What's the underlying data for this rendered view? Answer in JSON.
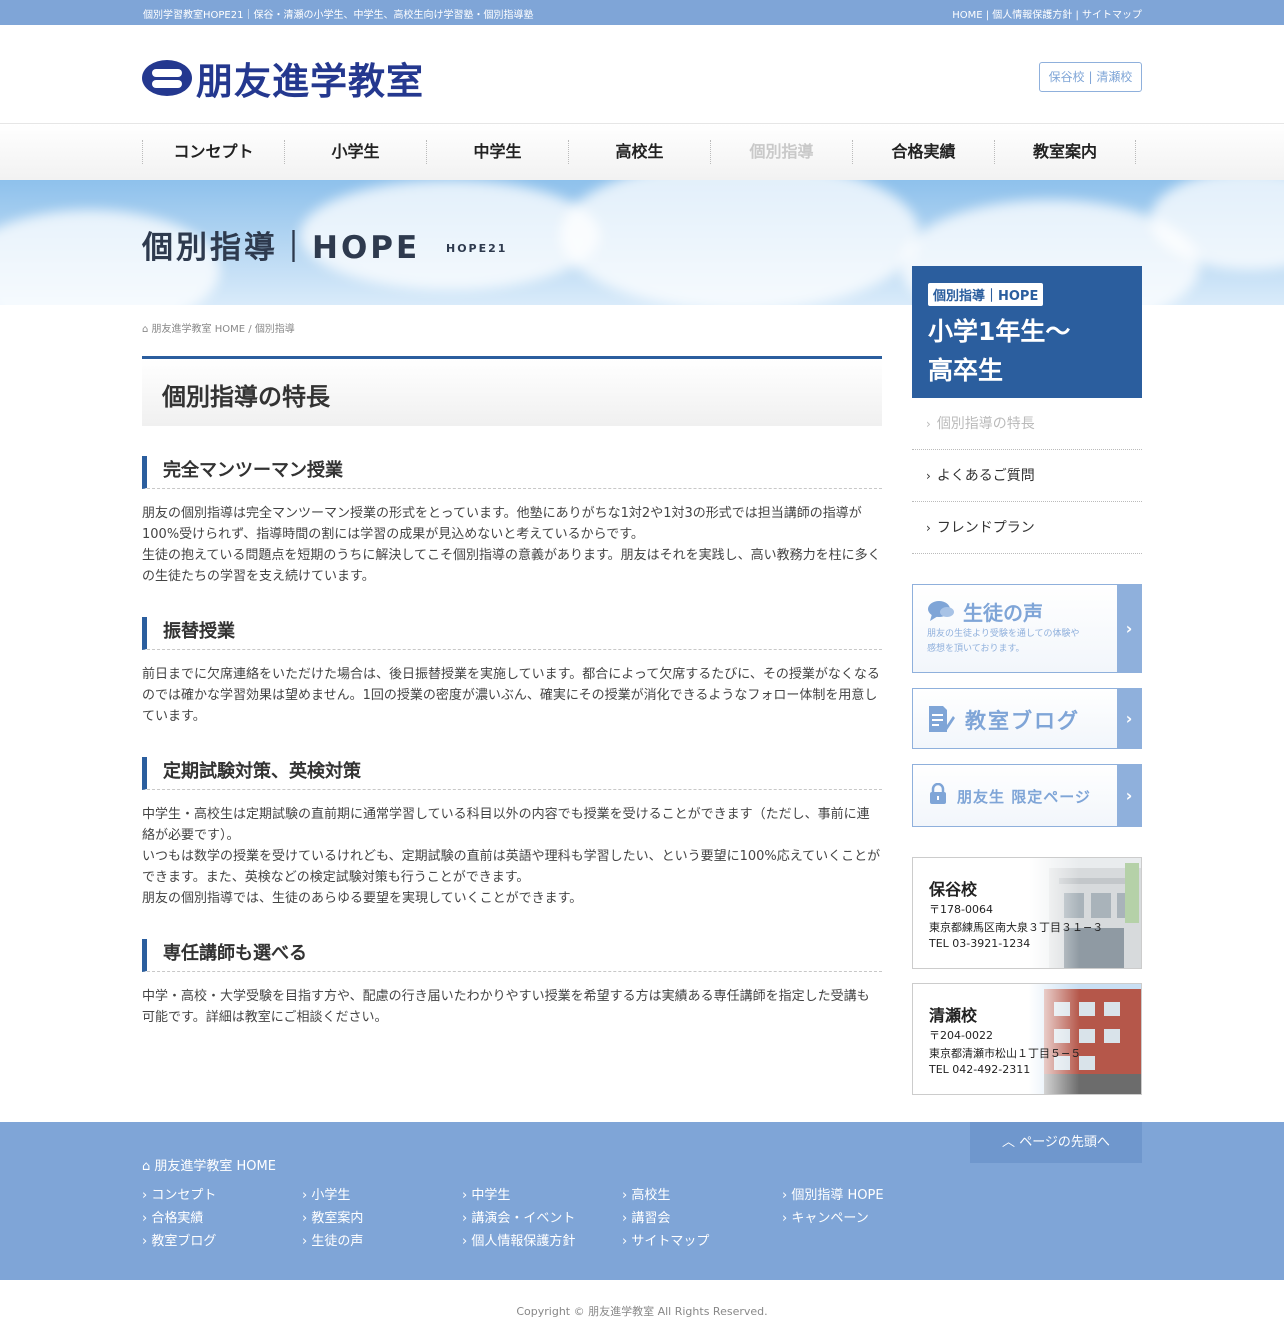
{
  "topbar": {
    "tagline": "個別学習教室HOPE21｜保谷・清瀬の小学生、中学生、高校生向け学習塾・個別指導塾",
    "links": [
      "HOME",
      "個人情報保護方針",
      "サイトマップ"
    ]
  },
  "header": {
    "logo_text": "朋友進学教室",
    "school_links": [
      "保谷校",
      "清瀬校"
    ]
  },
  "nav": {
    "items": [
      {
        "label": "コンセプト"
      },
      {
        "label": "小学生"
      },
      {
        "label": "中学生"
      },
      {
        "label": "高校生"
      },
      {
        "label": "個別指導"
      },
      {
        "label": "合格実績"
      },
      {
        "label": "教室案内"
      }
    ]
  },
  "hero": {
    "title": "個別指導｜HOPE",
    "subtitle": "HOPE21"
  },
  "side_banner": {
    "tag": "個別指導｜HOPE",
    "line1": "小学1年生〜",
    "line2": "高卒生"
  },
  "breadcrumb": {
    "home": "朋友進学教室 HOME",
    "separator": "/",
    "current": "個別指導"
  },
  "page_title": "個別指導の特長",
  "sections": [
    {
      "heading": "完全マンツーマン授業",
      "paragraphs": [
        "朋友の個別指導は完全マンツーマン授業の形式をとっています。他塾にありがちな1対2や1対3の形式では担当講師の指導が100%受けられず、指導時間の割には学習の成果が見込めないと考えているからです。",
        "生徒の抱えている問題点を短期のうちに解決してこそ個別指導の意義があります。朋友はそれを実践し、高い教務力を柱に多くの生徒たちの学習を支え続けています。"
      ]
    },
    {
      "heading": "振替授業",
      "paragraphs": [
        "前日までに欠席連絡をいただけた場合は、後日振替授業を実施しています。都合によって欠席するたびに、その授業がなくなるのでは確かな学習効果は望めません。1回の授業の密度が濃いぶん、確実にその授業が消化できるようなフォロー体制を用意しています。"
      ]
    },
    {
      "heading": "定期試験対策、英検対策",
      "paragraphs": [
        "中学生・高校生は定期試験の直前期に通常学習している科目以外の内容でも授業を受けることができます（ただし、事前に連絡が必要です）。",
        "いつもは数学の授業を受けているけれども、定期試験の直前は英語や理科も学習したい、という要望に100%応えていくことができます。また、英検などの検定試験対策も行うことができます。",
        "朋友の個別指導では、生徒のあらゆる要望を実現していくことができます。"
      ]
    },
    {
      "heading": "専任講師も選べる",
      "paragraphs": [
        "中学・高校・大学受験を目指す方や、配慮の行き届いたわかりやすい授業を希望する方は実績ある専任講師を指定した受講も可能です。詳細は教室にご相談ください。"
      ]
    }
  ],
  "side_nav": [
    {
      "label": "個別指導の特長"
    },
    {
      "label": "よくあるご質問"
    },
    {
      "label": "フレンドプラン"
    }
  ],
  "cta": {
    "voice_title": "生徒の声",
    "voice_desc_1": "朋友の生徒より受験を通しての体験や",
    "voice_desc_2": "感想を頂いております。",
    "blog_title": "教室ブログ",
    "members_title": "朋友生 限定ページ"
  },
  "schools": [
    {
      "name": "保谷校",
      "zip": "〒178-0064",
      "address": "東京都練馬区南大泉３丁目３１−３",
      "tel": "TEL 03-3921-1234"
    },
    {
      "name": "清瀬校",
      "zip": "〒204-0022",
      "address": "東京都清瀬市松山１丁目５−５",
      "tel": "TEL 042-492-2311"
    }
  ],
  "footer": {
    "pagetop": "ページの先頭へ",
    "home": "朋友進学教室 HOME",
    "columns": [
      [
        "コンセプト",
        "合格実績",
        "教室ブログ"
      ],
      [
        "小学生",
        "教室案内",
        "生徒の声"
      ],
      [
        "中学生",
        "講演会・イベント",
        "個人情報保護方針"
      ],
      [
        "高校生",
        "講習会",
        "サイトマップ"
      ],
      [
        "個別指導 HOPE",
        "キャンペーン"
      ]
    ]
  },
  "copyright": "Copyright © 朋友進学教室 All Rights Reserved."
}
